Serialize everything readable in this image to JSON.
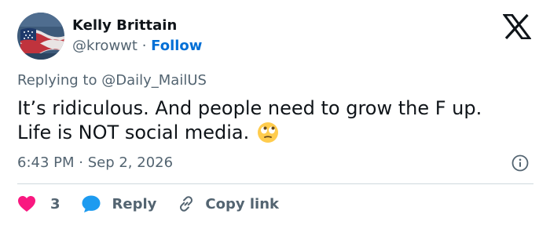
{
  "author": {
    "name": "Kelly Brittain",
    "handle": "@krowwt",
    "separator": "·",
    "follow_label": "Follow",
    "avatar_icon": "american-flag-avatar"
  },
  "platform_icon": "x-logo-icon",
  "reply_context": {
    "prefix": "Replying to",
    "mention": "@Daily_MailUS"
  },
  "tweet_text": {
    "line1": "It’s ridiculous. And people need to grow the F up.",
    "line2": "Life is NOT social media.",
    "emoji": "face-with-rolling-eyes-emoji"
  },
  "timestamp": "6:43 PM · Sep 2, 2026",
  "info_icon": "info-circle-icon",
  "actions": {
    "like_count": "3",
    "reply_label": "Reply",
    "copy_link_label": "Copy link"
  },
  "colors": {
    "text": "#0f1419",
    "secondary": "#536471",
    "follow": "#006fd6",
    "like": "#f91880",
    "reply": "#1d9bf0",
    "divider": "#cfd9de"
  }
}
